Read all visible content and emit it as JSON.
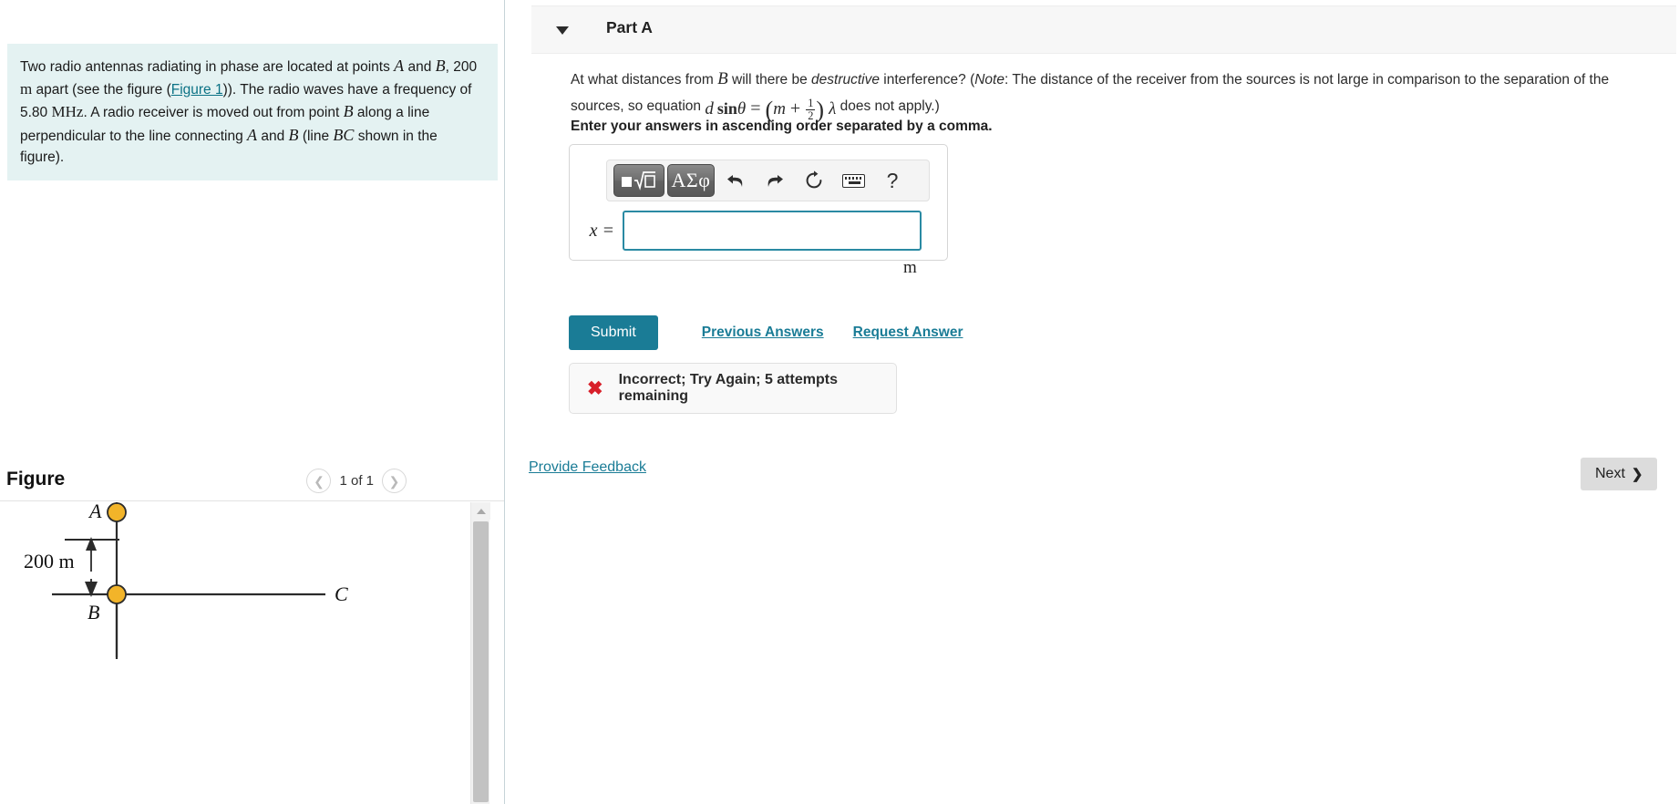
{
  "problem": {
    "text_part1": "Two radio antennas radiating in phase are located at points ",
    "label_A": "A",
    "text_part2": " and ",
    "label_B": "B",
    "text_part3": ", 200 ",
    "unit_m": "m",
    "text_part4": " apart (see the figure (",
    "figure_link": "Figure 1",
    "text_part5": ")). The radio waves have a frequency of 5.80 ",
    "unit_MHz": "MHz",
    "text_part6": ". A radio receiver is moved out from point ",
    "label_B2": "B",
    "text_part7": " along a line perpendicular to the line connecting ",
    "label_A2": "A",
    "text_part8": " and ",
    "label_B3": "B",
    "text_part9": " (line ",
    "label_BC": "BC",
    "text_part10": " shown in the figure)."
  },
  "figure": {
    "title": "Figure",
    "counter": "1 of 1",
    "prev_icon": "chevron-left-icon",
    "next_icon": "chevron-right-icon",
    "labels": {
      "A": "A",
      "B": "B",
      "C": "C",
      "distance": "200 m"
    },
    "antenna_color": "#f2b429"
  },
  "part": {
    "title": "Part A",
    "caret_icon": "caret-down-icon"
  },
  "question": {
    "line1_a": "At what distances from ",
    "sym_B": "B",
    "line1_b": " will there be ",
    "emph": "destructive",
    "line1_c": " interference? (",
    "note_label": "Note",
    "line1_d": ": The distance of the receiver from the sources is not large in comparison to the separation of the sources, so equation ",
    "eq_d": "d",
    "eq_sin": "sin",
    "eq_theta": "θ",
    "eq_equals": "=",
    "eq_m": "m",
    "eq_plus": "+",
    "eq_frac_num": "1",
    "eq_frac_den": "2",
    "eq_lambda": "λ",
    "line1_e": " does not apply.)",
    "instruction": "Enter your answers in ascending order separated by a comma."
  },
  "answer": {
    "toolbar": {
      "template_icon": "math-template-icon",
      "greek_label": "ΑΣφ",
      "undo_icon": "undo-arrow-icon",
      "redo_icon": "redo-arrow-icon",
      "reset_icon": "reset-circular-arrow-icon",
      "keyboard_icon": "keyboard-icon",
      "help_label": "?"
    },
    "variable_label": "x =",
    "value": "",
    "placeholder": "",
    "unit": "m",
    "border_color": "#2a8aa3"
  },
  "actions": {
    "submit_label": "Submit",
    "previous_answers_label": "Previous Answers",
    "request_answer_label": "Request Answer",
    "submit_color": "#1a7c96"
  },
  "feedback": {
    "icon": "x-mark-icon",
    "icon_color": "#d8202a",
    "message": "Incorrect; Try Again; 5 attempts remaining"
  },
  "footer": {
    "provide_feedback_label": "Provide Feedback",
    "next_label": "Next",
    "next_icon": "chevron-right-icon"
  }
}
